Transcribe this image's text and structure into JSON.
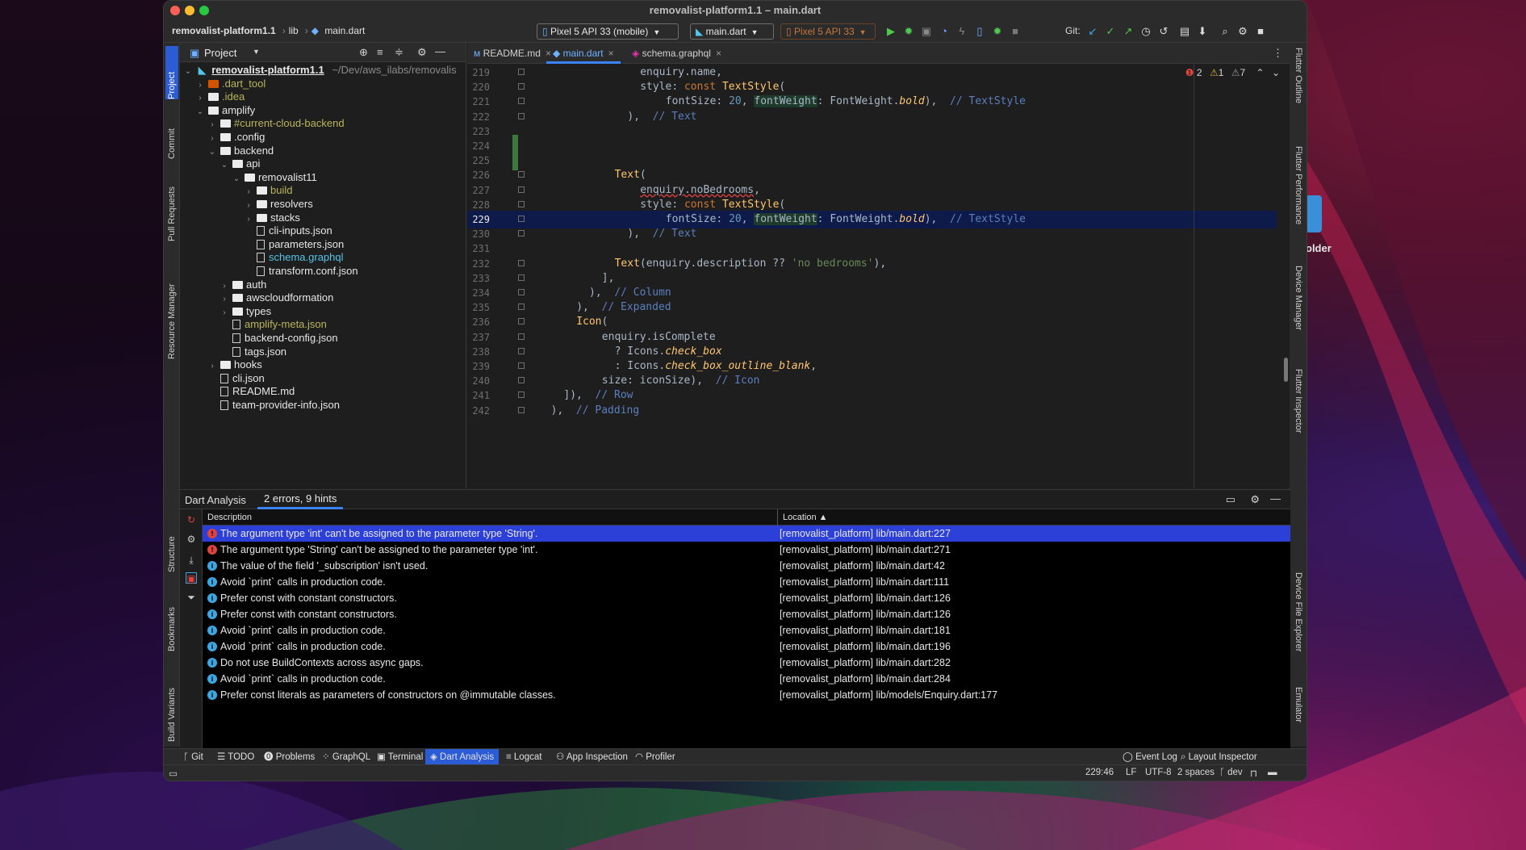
{
  "window": {
    "title": "removalist-platform1.1 – main.dart"
  },
  "desktop": {
    "folder_label": "older"
  },
  "breadcrumb": {
    "project": "removalist-platform1.1",
    "folder": "lib",
    "file": "main.dart"
  },
  "run_toolbar": {
    "device": "Pixel 5 API 33 (mobile)",
    "run_config": "main.dart",
    "device_secondary": "Pixel 5 API 33",
    "git_label": "Git:"
  },
  "left_tabs": [
    "Project",
    "Commit",
    "Pull Requests",
    "Resource Manager",
    "Structure",
    "Bookmarks",
    "Build Variants"
  ],
  "right_tabs": [
    "Flutter Outline",
    "Flutter Performance",
    "Device Manager",
    "Flutter Inspector",
    "Device File Explorer",
    "Emulator"
  ],
  "project_panel": {
    "title": "Project",
    "root_name": "removalist-platform1.1",
    "root_path": "~/Dev/aws_ilabs/removalis",
    "items": [
      {
        "label": ".dart_tool",
        "depth": 1,
        "type": "folder",
        "expanded": false,
        "color": "olive",
        "icon": "folder-orange"
      },
      {
        "label": ".idea",
        "depth": 1,
        "type": "folder",
        "expanded": false,
        "color": "olive"
      },
      {
        "label": "amplify",
        "depth": 1,
        "type": "folder",
        "expanded": true
      },
      {
        "label": "#current-cloud-backend",
        "depth": 2,
        "type": "folder",
        "expanded": false,
        "color": "olive"
      },
      {
        "label": ".config",
        "depth": 2,
        "type": "folder",
        "expanded": false
      },
      {
        "label": "backend",
        "depth": 2,
        "type": "folder",
        "expanded": true
      },
      {
        "label": "api",
        "depth": 3,
        "type": "folder",
        "expanded": true
      },
      {
        "label": "removalist11",
        "depth": 4,
        "type": "folder",
        "expanded": true
      },
      {
        "label": "build",
        "depth": 5,
        "type": "folder",
        "expanded": false,
        "color": "olive"
      },
      {
        "label": "resolvers",
        "depth": 5,
        "type": "folder",
        "expanded": false
      },
      {
        "label": "stacks",
        "depth": 5,
        "type": "folder",
        "expanded": false
      },
      {
        "label": "cli-inputs.json",
        "depth": 5,
        "type": "file"
      },
      {
        "label": "parameters.json",
        "depth": 5,
        "type": "file"
      },
      {
        "label": "schema.graphql",
        "depth": 5,
        "type": "file",
        "color": "cyan"
      },
      {
        "label": "transform.conf.json",
        "depth": 5,
        "type": "file"
      },
      {
        "label": "auth",
        "depth": 3,
        "type": "folder",
        "expanded": false
      },
      {
        "label": "awscloudformation",
        "depth": 3,
        "type": "folder",
        "expanded": false
      },
      {
        "label": "types",
        "depth": 3,
        "type": "folder",
        "expanded": false
      },
      {
        "label": "amplify-meta.json",
        "depth": 3,
        "type": "file",
        "color": "olive"
      },
      {
        "label": "backend-config.json",
        "depth": 3,
        "type": "file"
      },
      {
        "label": "tags.json",
        "depth": 3,
        "type": "file"
      },
      {
        "label": "hooks",
        "depth": 2,
        "type": "folder",
        "expanded": false
      },
      {
        "label": "cli.json",
        "depth": 2,
        "type": "file"
      },
      {
        "label": "README.md",
        "depth": 2,
        "type": "file"
      },
      {
        "label": "team-provider-info.json",
        "depth": 2,
        "type": "file"
      }
    ]
  },
  "editor": {
    "tabs": [
      {
        "label": "README.md",
        "active": false
      },
      {
        "label": "main.dart",
        "active": true
      },
      {
        "label": "schema.graphql",
        "active": false
      }
    ],
    "inspection": {
      "errors": "2",
      "warnings": "1",
      "hints": "7"
    },
    "current_line": 229,
    "lines": [
      {
        "n": "219",
        "code": "enquiry.name,"
      },
      {
        "n": "220",
        "code": "style: const TextStyle("
      },
      {
        "n": "221",
        "code": "fontSize: 20, fontWeight: FontWeight.bold),  // TextStyle"
      },
      {
        "n": "222",
        "code": "),  // Text"
      },
      {
        "n": "223",
        "code": ""
      },
      {
        "n": "224",
        "code": ""
      },
      {
        "n": "225",
        "code": ""
      },
      {
        "n": "226",
        "code": "Text("
      },
      {
        "n": "227",
        "code": "enquiry.noBedrooms,"
      },
      {
        "n": "228",
        "code": "style: const TextStyle("
      },
      {
        "n": "229",
        "code": "fontSize: 20, fontWeight: FontWeight.bold),  // TextStyle"
      },
      {
        "n": "230",
        "code": "),  // Text"
      },
      {
        "n": "231",
        "code": ""
      },
      {
        "n": "232",
        "code": "Text(enquiry.description ?? 'no bedrooms'),"
      },
      {
        "n": "233",
        "code": "],"
      },
      {
        "n": "234",
        "code": "),  // Column"
      },
      {
        "n": "235",
        "code": "),  // Expanded"
      },
      {
        "n": "236",
        "code": "Icon("
      },
      {
        "n": "237",
        "code": "enquiry.isComplete"
      },
      {
        "n": "238",
        "code": "? Icons.check_box"
      },
      {
        "n": "239",
        "code": ": Icons.check_box_outline_blank,"
      },
      {
        "n": "240",
        "code": "size: iconSize),  // Icon"
      },
      {
        "n": "241",
        "code": "]),  // Row"
      },
      {
        "n": "242",
        "code": "),  // Padding"
      }
    ]
  },
  "analysis": {
    "title": "Dart Analysis",
    "summary": "2 errors, 9 hints",
    "col_description": "Description",
    "col_location": "Location",
    "rows": [
      {
        "severity": "error",
        "description": "The argument type 'int' can't be assigned to the parameter type 'String'.",
        "location": "[removalist_platform] lib/main.dart:227"
      },
      {
        "severity": "error",
        "description": "The argument type 'String' can't be assigned to the parameter type 'int'.",
        "location": "[removalist_platform] lib/main.dart:271"
      },
      {
        "severity": "hint",
        "description": "The value of the field '_subscription' isn't used.",
        "location": "[removalist_platform] lib/main.dart:42"
      },
      {
        "severity": "hint",
        "description": "Avoid `print` calls in production code.",
        "location": "[removalist_platform] lib/main.dart:111"
      },
      {
        "severity": "hint",
        "description": "Prefer const with constant constructors.",
        "location": "[removalist_platform] lib/main.dart:126"
      },
      {
        "severity": "hint",
        "description": "Prefer const with constant constructors.",
        "location": "[removalist_platform] lib/main.dart:126"
      },
      {
        "severity": "hint",
        "description": "Avoid `print` calls in production code.",
        "location": "[removalist_platform] lib/main.dart:181"
      },
      {
        "severity": "hint",
        "description": "Avoid `print` calls in production code.",
        "location": "[removalist_platform] lib/main.dart:196"
      },
      {
        "severity": "hint",
        "description": "Do not use BuildContexts across async gaps.",
        "location": "[removalist_platform] lib/main.dart:282"
      },
      {
        "severity": "hint",
        "description": "Avoid `print` calls in production code.",
        "location": "[removalist_platform] lib/main.dart:284"
      },
      {
        "severity": "hint",
        "description": "Prefer const literals as parameters of constructors on @immutable classes.",
        "location": "[removalist_platform] lib/models/Enquiry.dart:177"
      }
    ]
  },
  "tool_windows": [
    {
      "label": "Git",
      "active": false
    },
    {
      "label": "TODO",
      "active": false
    },
    {
      "label": "Problems",
      "active": false
    },
    {
      "label": "GraphQL",
      "active": false
    },
    {
      "label": "Terminal",
      "active": false
    },
    {
      "label": "Dart Analysis",
      "active": true
    },
    {
      "label": "Logcat",
      "active": false
    },
    {
      "label": "App Inspection",
      "active": false
    },
    {
      "label": "Profiler",
      "active": false
    }
  ],
  "tool_windows_right": [
    "Event Log",
    "Layout Inspector"
  ],
  "status_bar": {
    "position": "229:46",
    "line_sep": "LF",
    "encoding": "UTF-8",
    "indent": "2 spaces",
    "branch": "dev"
  },
  "colors": {
    "accent": "#2c5bd6",
    "error": "#e0443e",
    "hint": "#3fa7e0",
    "selection": "#2c40d8"
  }
}
